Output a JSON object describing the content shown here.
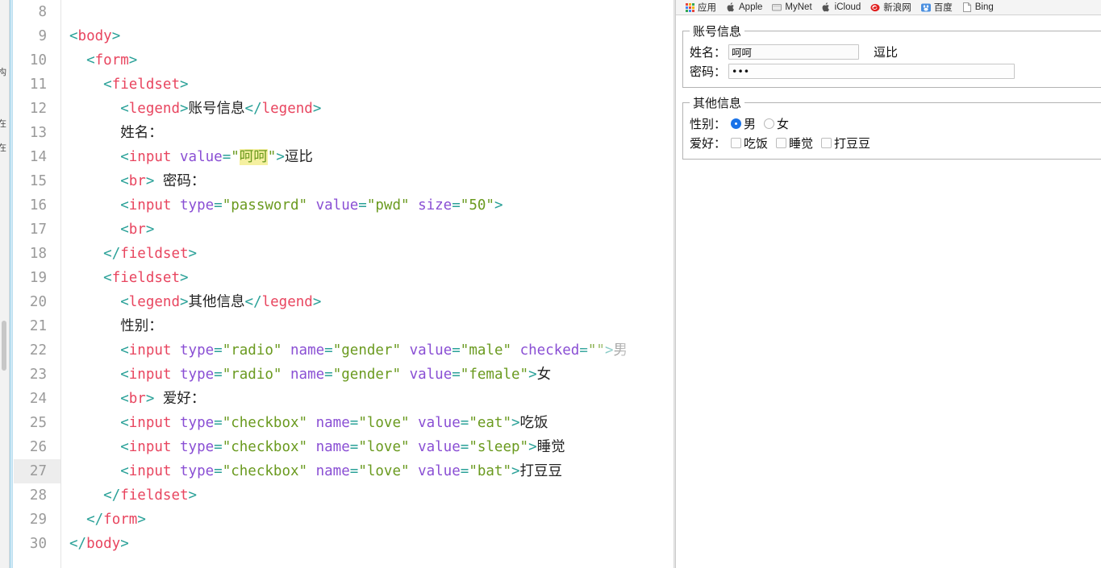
{
  "editor": {
    "active_line": 27,
    "first_line": 8,
    "lines": [
      {
        "n": "8",
        "tokens": []
      },
      {
        "n": "9",
        "tokens": [
          {
            "t": "punct",
            "s": "<"
          },
          {
            "t": "tag",
            "s": "body"
          },
          {
            "t": "punct",
            "s": ">"
          }
        ]
      },
      {
        "n": "10",
        "tokens": [
          {
            "t": "text",
            "s": "  "
          },
          {
            "t": "punct",
            "s": "<"
          },
          {
            "t": "tag",
            "s": "form"
          },
          {
            "t": "punct",
            "s": ">"
          }
        ]
      },
      {
        "n": "11",
        "tokens": [
          {
            "t": "text",
            "s": "    "
          },
          {
            "t": "punct",
            "s": "<"
          },
          {
            "t": "tag",
            "s": "fieldset"
          },
          {
            "t": "punct",
            "s": ">"
          }
        ]
      },
      {
        "n": "12",
        "tokens": [
          {
            "t": "text",
            "s": "      "
          },
          {
            "t": "punct",
            "s": "<"
          },
          {
            "t": "tag",
            "s": "legend"
          },
          {
            "t": "punct",
            "s": ">"
          },
          {
            "t": "text",
            "s": "账号信息"
          },
          {
            "t": "punct",
            "s": "</"
          },
          {
            "t": "tag",
            "s": "legend"
          },
          {
            "t": "punct",
            "s": ">"
          }
        ]
      },
      {
        "n": "13",
        "tokens": [
          {
            "t": "text",
            "s": "      姓名："
          }
        ]
      },
      {
        "n": "14",
        "tokens": [
          {
            "t": "text",
            "s": "      "
          },
          {
            "t": "punct",
            "s": "<"
          },
          {
            "t": "tag",
            "s": "input"
          },
          {
            "t": "text",
            "s": " "
          },
          {
            "t": "attr",
            "s": "value"
          },
          {
            "t": "punct",
            "s": "="
          },
          {
            "t": "str",
            "s": "\""
          },
          {
            "t": "hl",
            "s": "呵呵"
          },
          {
            "t": "str",
            "s": "\""
          },
          {
            "t": "punct",
            "s": ">"
          },
          {
            "t": "text",
            "s": "逗比"
          }
        ]
      },
      {
        "n": "15",
        "tokens": [
          {
            "t": "text",
            "s": "      "
          },
          {
            "t": "punct",
            "s": "<"
          },
          {
            "t": "tag",
            "s": "br"
          },
          {
            "t": "punct",
            "s": ">"
          },
          {
            "t": "text",
            "s": " 密码："
          }
        ]
      },
      {
        "n": "16",
        "tokens": [
          {
            "t": "text",
            "s": "      "
          },
          {
            "t": "punct",
            "s": "<"
          },
          {
            "t": "tag",
            "s": "input"
          },
          {
            "t": "text",
            "s": " "
          },
          {
            "t": "attr",
            "s": "type"
          },
          {
            "t": "punct",
            "s": "="
          },
          {
            "t": "str",
            "s": "\"password\""
          },
          {
            "t": "text",
            "s": " "
          },
          {
            "t": "attr",
            "s": "value"
          },
          {
            "t": "punct",
            "s": "="
          },
          {
            "t": "str",
            "s": "\"pwd\""
          },
          {
            "t": "text",
            "s": " "
          },
          {
            "t": "attr",
            "s": "size"
          },
          {
            "t": "punct",
            "s": "="
          },
          {
            "t": "str",
            "s": "\"50\""
          },
          {
            "t": "punct",
            "s": ">"
          }
        ]
      },
      {
        "n": "17",
        "tokens": [
          {
            "t": "text",
            "s": "      "
          },
          {
            "t": "punct",
            "s": "<"
          },
          {
            "t": "tag",
            "s": "br"
          },
          {
            "t": "punct",
            "s": ">"
          }
        ]
      },
      {
        "n": "18",
        "tokens": [
          {
            "t": "text",
            "s": "    "
          },
          {
            "t": "punct",
            "s": "</"
          },
          {
            "t": "tag",
            "s": "fieldset"
          },
          {
            "t": "punct",
            "s": ">"
          }
        ]
      },
      {
        "n": "19",
        "tokens": [
          {
            "t": "text",
            "s": "    "
          },
          {
            "t": "punct",
            "s": "<"
          },
          {
            "t": "tag",
            "s": "fieldset"
          },
          {
            "t": "punct",
            "s": ">"
          }
        ]
      },
      {
        "n": "20",
        "tokens": [
          {
            "t": "text",
            "s": "      "
          },
          {
            "t": "punct",
            "s": "<"
          },
          {
            "t": "tag",
            "s": "legend"
          },
          {
            "t": "punct",
            "s": ">"
          },
          {
            "t": "text",
            "s": "其他信息"
          },
          {
            "t": "punct",
            "s": "</"
          },
          {
            "t": "tag",
            "s": "legend"
          },
          {
            "t": "punct",
            "s": ">"
          }
        ]
      },
      {
        "n": "21",
        "tokens": [
          {
            "t": "text",
            "s": "      性别："
          }
        ]
      },
      {
        "n": "22",
        "tokens": [
          {
            "t": "text",
            "s": "      "
          },
          {
            "t": "punct",
            "s": "<"
          },
          {
            "t": "tag",
            "s": "input"
          },
          {
            "t": "text",
            "s": " "
          },
          {
            "t": "attr",
            "s": "type"
          },
          {
            "t": "punct",
            "s": "="
          },
          {
            "t": "str",
            "s": "\"radio\""
          },
          {
            "t": "text",
            "s": " "
          },
          {
            "t": "attr",
            "s": "name"
          },
          {
            "t": "punct",
            "s": "="
          },
          {
            "t": "str",
            "s": "\"gender\""
          },
          {
            "t": "text",
            "s": " "
          },
          {
            "t": "attr",
            "s": "value"
          },
          {
            "t": "punct",
            "s": "="
          },
          {
            "t": "str",
            "s": "\"male\""
          },
          {
            "t": "text",
            "s": " "
          },
          {
            "t": "attr",
            "s": "checked"
          },
          {
            "t": "punct",
            "s": "="
          },
          {
            "t": "str",
            "s": "\"\""
          },
          {
            "t": "punct",
            "s": ">"
          },
          {
            "t": "text",
            "s": "男"
          }
        ]
      },
      {
        "n": "23",
        "tokens": [
          {
            "t": "text",
            "s": "      "
          },
          {
            "t": "punct",
            "s": "<"
          },
          {
            "t": "tag",
            "s": "input"
          },
          {
            "t": "text",
            "s": " "
          },
          {
            "t": "attr",
            "s": "type"
          },
          {
            "t": "punct",
            "s": "="
          },
          {
            "t": "str",
            "s": "\"radio\""
          },
          {
            "t": "text",
            "s": " "
          },
          {
            "t": "attr",
            "s": "name"
          },
          {
            "t": "punct",
            "s": "="
          },
          {
            "t": "str",
            "s": "\"gender\""
          },
          {
            "t": "text",
            "s": " "
          },
          {
            "t": "attr",
            "s": "value"
          },
          {
            "t": "punct",
            "s": "="
          },
          {
            "t": "str",
            "s": "\"female\""
          },
          {
            "t": "punct",
            "s": ">"
          },
          {
            "t": "text",
            "s": "女"
          }
        ]
      },
      {
        "n": "24",
        "tokens": [
          {
            "t": "text",
            "s": "      "
          },
          {
            "t": "punct",
            "s": "<"
          },
          {
            "t": "tag",
            "s": "br"
          },
          {
            "t": "punct",
            "s": ">"
          },
          {
            "t": "text",
            "s": " 爱好："
          }
        ]
      },
      {
        "n": "25",
        "tokens": [
          {
            "t": "text",
            "s": "      "
          },
          {
            "t": "punct",
            "s": "<"
          },
          {
            "t": "tag",
            "s": "input"
          },
          {
            "t": "text",
            "s": " "
          },
          {
            "t": "attr",
            "s": "type"
          },
          {
            "t": "punct",
            "s": "="
          },
          {
            "t": "str",
            "s": "\"checkbox\""
          },
          {
            "t": "text",
            "s": " "
          },
          {
            "t": "attr",
            "s": "name"
          },
          {
            "t": "punct",
            "s": "="
          },
          {
            "t": "str",
            "s": "\"love\""
          },
          {
            "t": "text",
            "s": " "
          },
          {
            "t": "attr",
            "s": "value"
          },
          {
            "t": "punct",
            "s": "="
          },
          {
            "t": "str",
            "s": "\"eat\""
          },
          {
            "t": "punct",
            "s": ">"
          },
          {
            "t": "text",
            "s": "吃饭"
          }
        ]
      },
      {
        "n": "26",
        "tokens": [
          {
            "t": "text",
            "s": "      "
          },
          {
            "t": "punct",
            "s": "<"
          },
          {
            "t": "tag",
            "s": "input"
          },
          {
            "t": "text",
            "s": " "
          },
          {
            "t": "attr",
            "s": "type"
          },
          {
            "t": "punct",
            "s": "="
          },
          {
            "t": "str",
            "s": "\"checkbox\""
          },
          {
            "t": "text",
            "s": " "
          },
          {
            "t": "attr",
            "s": "name"
          },
          {
            "t": "punct",
            "s": "="
          },
          {
            "t": "str",
            "s": "\"love\""
          },
          {
            "t": "text",
            "s": " "
          },
          {
            "t": "attr",
            "s": "value"
          },
          {
            "t": "punct",
            "s": "="
          },
          {
            "t": "str",
            "s": "\"sleep\""
          },
          {
            "t": "punct",
            "s": ">"
          },
          {
            "t": "text",
            "s": "睡觉"
          }
        ]
      },
      {
        "n": "27",
        "tokens": [
          {
            "t": "text",
            "s": "      "
          },
          {
            "t": "punct",
            "s": "<"
          },
          {
            "t": "tag",
            "s": "input"
          },
          {
            "t": "text",
            "s": " "
          },
          {
            "t": "attr",
            "s": "type"
          },
          {
            "t": "punct",
            "s": "="
          },
          {
            "t": "str",
            "s": "\"checkbox\""
          },
          {
            "t": "text",
            "s": " "
          },
          {
            "t": "attr",
            "s": "name"
          },
          {
            "t": "punct",
            "s": "="
          },
          {
            "t": "str",
            "s": "\"love\""
          },
          {
            "t": "text",
            "s": " "
          },
          {
            "t": "attr",
            "s": "value"
          },
          {
            "t": "punct",
            "s": "="
          },
          {
            "t": "str",
            "s": "\"bat\""
          },
          {
            "t": "punct",
            "s": ">"
          },
          {
            "t": "text",
            "s": "打豆豆"
          }
        ]
      },
      {
        "n": "28",
        "tokens": [
          {
            "t": "text",
            "s": "    "
          },
          {
            "t": "punct",
            "s": "</"
          },
          {
            "t": "tag",
            "s": "fieldset"
          },
          {
            "t": "punct",
            "s": ">"
          }
        ]
      },
      {
        "n": "29",
        "tokens": [
          {
            "t": "text",
            "s": "  "
          },
          {
            "t": "punct",
            "s": "</"
          },
          {
            "t": "tag",
            "s": "form"
          },
          {
            "t": "punct",
            "s": ">"
          }
        ]
      },
      {
        "n": "30",
        "tokens": [
          {
            "t": "punct",
            "s": "</"
          },
          {
            "t": "tag",
            "s": "body"
          },
          {
            "t": "punct",
            "s": ">"
          }
        ]
      }
    ]
  },
  "sidebar_strip": {
    "labels": [
      "构",
      "在",
      "在"
    ]
  },
  "browser": {
    "bookmarks": [
      {
        "label": "应用",
        "icon": "apps-grid-icon"
      },
      {
        "label": "Apple",
        "icon": "apple-logo-icon"
      },
      {
        "label": "MyNet",
        "icon": "folder-icon"
      },
      {
        "label": "iCloud",
        "icon": "apple-logo-icon"
      },
      {
        "label": "新浪网",
        "icon": "sina-logo-icon"
      },
      {
        "label": "百度",
        "icon": "baidu-logo-icon"
      },
      {
        "label": "Bing",
        "icon": "page-icon"
      }
    ],
    "page": {
      "fieldset_account": {
        "legend": "账号信息",
        "name_label": "姓名：",
        "name_value": "呵呵",
        "name_trailing_text": "逗比",
        "password_label": "密码：",
        "password_value": "•••"
      },
      "fieldset_other": {
        "legend": "其他信息",
        "gender_label": "性别：",
        "gender_options": [
          {
            "label": "男",
            "checked": true
          },
          {
            "label": "女",
            "checked": false
          }
        ],
        "hobby_label": "爱好：",
        "hobby_options": [
          {
            "label": "吃饭",
            "checked": false
          },
          {
            "label": "睡觉",
            "checked": false
          },
          {
            "label": "打豆豆",
            "checked": false
          }
        ]
      }
    }
  },
  "colors": {
    "punct": "#2aa198",
    "tag": "#e8455f",
    "attr": "#8a4fd4",
    "string": "#6a9a1f",
    "highlight": "#f5f0a0",
    "radio_checked": "#1a73e8",
    "accent_border": "#cfe8f5"
  }
}
